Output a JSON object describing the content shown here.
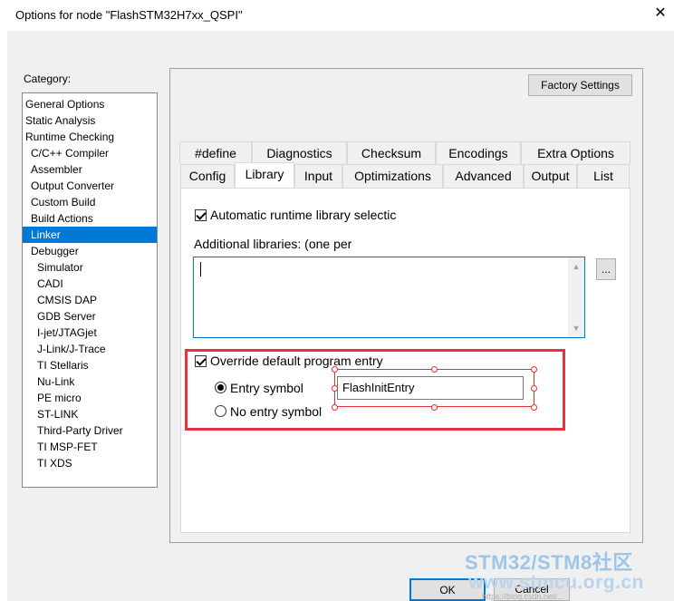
{
  "window": {
    "title": "Options for node \"FlashSTM32H7xx_QSPI\"",
    "close_glyph": "✕"
  },
  "category": {
    "label": "Category:",
    "items": [
      {
        "label": "General Options",
        "indent": 0
      },
      {
        "label": "Static Analysis",
        "indent": 0
      },
      {
        "label": "Runtime Checking",
        "indent": 0
      },
      {
        "label": "C/C++ Compiler",
        "indent": 1
      },
      {
        "label": "Assembler",
        "indent": 1
      },
      {
        "label": "Output Converter",
        "indent": 1
      },
      {
        "label": "Custom Build",
        "indent": 1
      },
      {
        "label": "Build Actions",
        "indent": 1
      },
      {
        "label": "Linker",
        "indent": 1,
        "selected": true
      },
      {
        "label": "Debugger",
        "indent": 1
      },
      {
        "label": "Simulator",
        "indent": 2
      },
      {
        "label": "CADI",
        "indent": 2
      },
      {
        "label": "CMSIS DAP",
        "indent": 2
      },
      {
        "label": "GDB Server",
        "indent": 2
      },
      {
        "label": "I-jet/JTAGjet",
        "indent": 2
      },
      {
        "label": "J-Link/J-Trace",
        "indent": 2
      },
      {
        "label": "TI Stellaris",
        "indent": 2
      },
      {
        "label": "Nu-Link",
        "indent": 2
      },
      {
        "label": "PE micro",
        "indent": 2
      },
      {
        "label": "ST-LINK",
        "indent": 2
      },
      {
        "label": "Third-Party Driver",
        "indent": 2
      },
      {
        "label": "TI MSP-FET",
        "indent": 2
      },
      {
        "label": "TI XDS",
        "indent": 2
      }
    ]
  },
  "panel": {
    "factory_settings_label": "Factory Settings"
  },
  "tabs": {
    "row1": [
      "#define",
      "Diagnostics",
      "Checksum",
      "Encodings",
      "Extra Options"
    ],
    "row2": [
      "Config",
      "Library",
      "Input",
      "Optimizations",
      "Advanced",
      "Output",
      "List"
    ],
    "active": "Library"
  },
  "library": {
    "auto_runtime_label": "Automatic runtime library selectic",
    "auto_runtime_checked": true,
    "additional_libraries_label": "Additional libraries: (one per",
    "additional_libraries_value": "",
    "browse_label": "...",
    "override_entry_label": "Override default program entry",
    "override_entry_checked": true,
    "entry_symbol_label": "Entry symbol",
    "entry_symbol_selected": true,
    "entry_symbol_value": "FlashInitEntry",
    "no_entry_symbol_label": "No entry symbol"
  },
  "footer": {
    "ok_label": "OK",
    "cancel_label": "Cancel"
  },
  "watermark": {
    "line1": "STM32/STM8社区",
    "line2": "www.stmcu.org.cn",
    "line3": "https://blog.csdn.net/..."
  },
  "colors": {
    "selection": "#0078d7",
    "highlight_box": "#e8333c"
  }
}
